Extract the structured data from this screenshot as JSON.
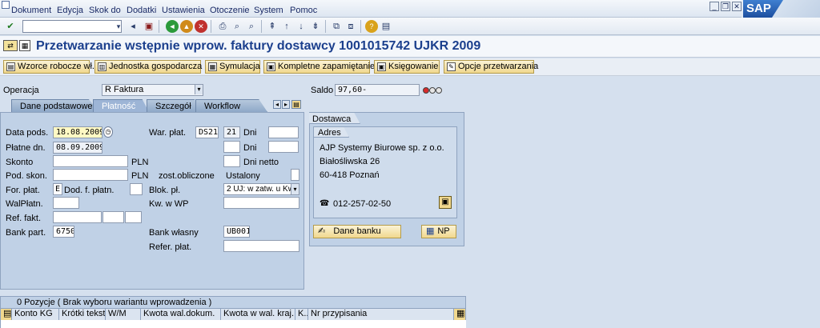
{
  "menu": [
    "Dokument",
    "Edycja",
    "Skok do",
    "Dodatki",
    "Ustawienia",
    "Otoczenie",
    "System",
    "Pomoc"
  ],
  "logo_text": "SAP",
  "title": "Przetwarzanie wstępnie wprow. faktury dostawcy 1001015742 UJKR 2009",
  "app_buttons": [
    "Wzorce robocze wł.",
    "Jednostka gospodarcza",
    "Symulacja",
    "Kompletne zapamiętanie",
    "Księgowanie",
    "Opcje przetwarzania"
  ],
  "operacja": {
    "label": "Operacja",
    "value": "R Faktura"
  },
  "saldo": {
    "label": "Saldo",
    "value": "97,60-"
  },
  "tabs": [
    "Dane podstawowe",
    "Płatność",
    "Szczegół",
    "Workflow"
  ],
  "payment": {
    "data_pods": {
      "label": "Data pods.",
      "value": "18.08.2009"
    },
    "platne_dn": {
      "label": "Płatne dn.",
      "value": "08.09.2009"
    },
    "skonto": {
      "label": "Skonto",
      "unit": "PLN"
    },
    "pod_skon": {
      "label": "Pod. skon.",
      "unit": "PLN"
    },
    "zost_obliczone": "zost.obliczone",
    "ustalony": "Ustalony",
    "for_plat": {
      "label": "For. płat.",
      "value": "E"
    },
    "dod_f_platn": "Dod. f. płatn.",
    "walplatn": "WalPłatn.",
    "ref_fakt": "Ref. fakt.",
    "bank_part": {
      "label": "Bank part.",
      "value": "6750"
    },
    "war_plat": {
      "label": "War. płat.",
      "value": "DS21",
      "days": "21",
      "dni": "Dni"
    },
    "dni2": "Dni",
    "dni_netto": "Dni netto",
    "blok_pl": {
      "label": "Blok. pł.",
      "value": "2 UJ: w zatw. u Kw"
    },
    "kw_w_wp": "Kw. w WP",
    "bank_wlasny": {
      "label": "Bank własny",
      "value": "UB001"
    },
    "refer_plat": "Refer. płat."
  },
  "dostawca": {
    "title": "Dostawca",
    "adres_title": "Adres",
    "name": "AJP Systemy Biurowe sp. z o.o.",
    "street": "Białośliwska 26",
    "city": "60-418 Poznań",
    "phone": "012-257-02-50",
    "bank_button": "Dane banku",
    "np_button": "NP"
  },
  "table": {
    "header": "0 Pozycje ( Brak wyboru wariantu wprowadzenia )",
    "columns": [
      "Konto KG",
      "Krótki tekst",
      "W/M",
      "Kwota wal.dokum.",
      "Kwota w wal. kraj.",
      "K..",
      "Nr przypisania"
    ]
  },
  "colors": {
    "accent": "#1b3f8d",
    "panel": "#c0d1e6",
    "button": "#f1d88e",
    "required": "#fff9c4"
  }
}
